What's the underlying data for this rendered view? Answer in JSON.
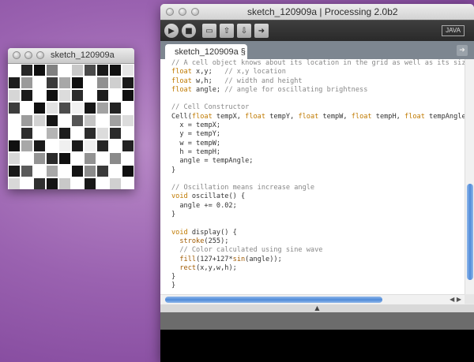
{
  "sketch_window": {
    "title": "sketch_120909a",
    "cells": [
      "#ffffff",
      "#262626",
      "#101010",
      "#808080",
      "#ffffff",
      "#c8c8c8",
      "#4a4a4a",
      "#1a1a1a",
      "#111111",
      "#e6e6e6",
      "#1e1e1e",
      "#9a9a9a",
      "#ffffff",
      "#3a3a3a",
      "#a8a8a8",
      "#101010",
      "#ffffff",
      "#909090",
      "#cfcfcf",
      "#1a1a1a",
      "#d6d6d6",
      "#1a1a1a",
      "#ffffff",
      "#101010",
      "#dcdcdc",
      "#2c2c2c",
      "#ffffff",
      "#1c1c1c",
      "#ffffff",
      "#101010",
      "#3c3c3c",
      "#ffffff",
      "#101010",
      "#e2e2e2",
      "#4c4c4c",
      "#f2f2f2",
      "#161616",
      "#a2a2a2",
      "#222222",
      "#ffffff",
      "#ffffff",
      "#9c9c9c",
      "#d2d2d2",
      "#161616",
      "#ffffff",
      "#545454",
      "#c4c4c4",
      "#ffffff",
      "#a0a0a0",
      "#dcdcdc",
      "#ffffff",
      "#2c2c2c",
      "#ffffff",
      "#b4b4b4",
      "#1c1c1c",
      "#ffffff",
      "#2c2c2c",
      "#dcdcdc",
      "#2a2a2a",
      "#ffffff",
      "#101010",
      "#a8a8a8",
      "#1a1a1a",
      "#ffffff",
      "#f0f0f0",
      "#1c1c1c",
      "#f0f0f0",
      "#262626",
      "#ffffff",
      "#222222",
      "#d8d8d8",
      "#ffffff",
      "#949494",
      "#2a2a2a",
      "#101010",
      "#ffffff",
      "#929292",
      "#ffffff",
      "#8a8a8a",
      "#ffffff",
      "#1a1a1a",
      "#5a5a5a",
      "#ffffff",
      "#a8a8a8",
      "#ffffff",
      "#141414",
      "#8c8c8c",
      "#3a3a3a",
      "#ffffff",
      "#101010",
      "#d8d8d8",
      "#ffffff",
      "#303030",
      "#141414",
      "#c8c8c8",
      "#ffffff",
      "#181818",
      "#ffffff",
      "#d0d0d0",
      "#ffffff"
    ]
  },
  "ide": {
    "title": "sketch_120909a | Processing 2.0b2",
    "mode": "JAVA",
    "tab": "sketch_120909a §",
    "toolbar": {
      "run_icon": "play-icon",
      "stop_icon": "stop-icon",
      "new_icon": "new-file-icon",
      "open_icon": "open-arrow-icon",
      "save_icon": "save-arrow-icon",
      "export_icon": "export-icon"
    },
    "code_lines": [
      "// A cell object knows about its location in the grid as well as its size with",
      "float x,y;   // x,y location",
      "float w,h;   // width and height",
      "float angle; // angle for oscillating brightness",
      "",
      "// Cell Constructor",
      "Cell(float tempX, float tempY, float tempW, float tempH, float tempAngle) {",
      "  x = tempX;",
      "  y = tempY;",
      "  w = tempW;",
      "  h = tempH;",
      "  angle = tempAngle;",
      "}",
      "",
      "// Oscillation means increase angle",
      "void oscillate() {",
      "  angle += 0.02;",
      "}",
      "",
      "void display() {",
      "  stroke(255);",
      "  // Color calculated using sine wave",
      "  fill(127+127*sin(angle));",
      "  rect(x,y,w,h);",
      "}",
      "}"
    ]
  }
}
